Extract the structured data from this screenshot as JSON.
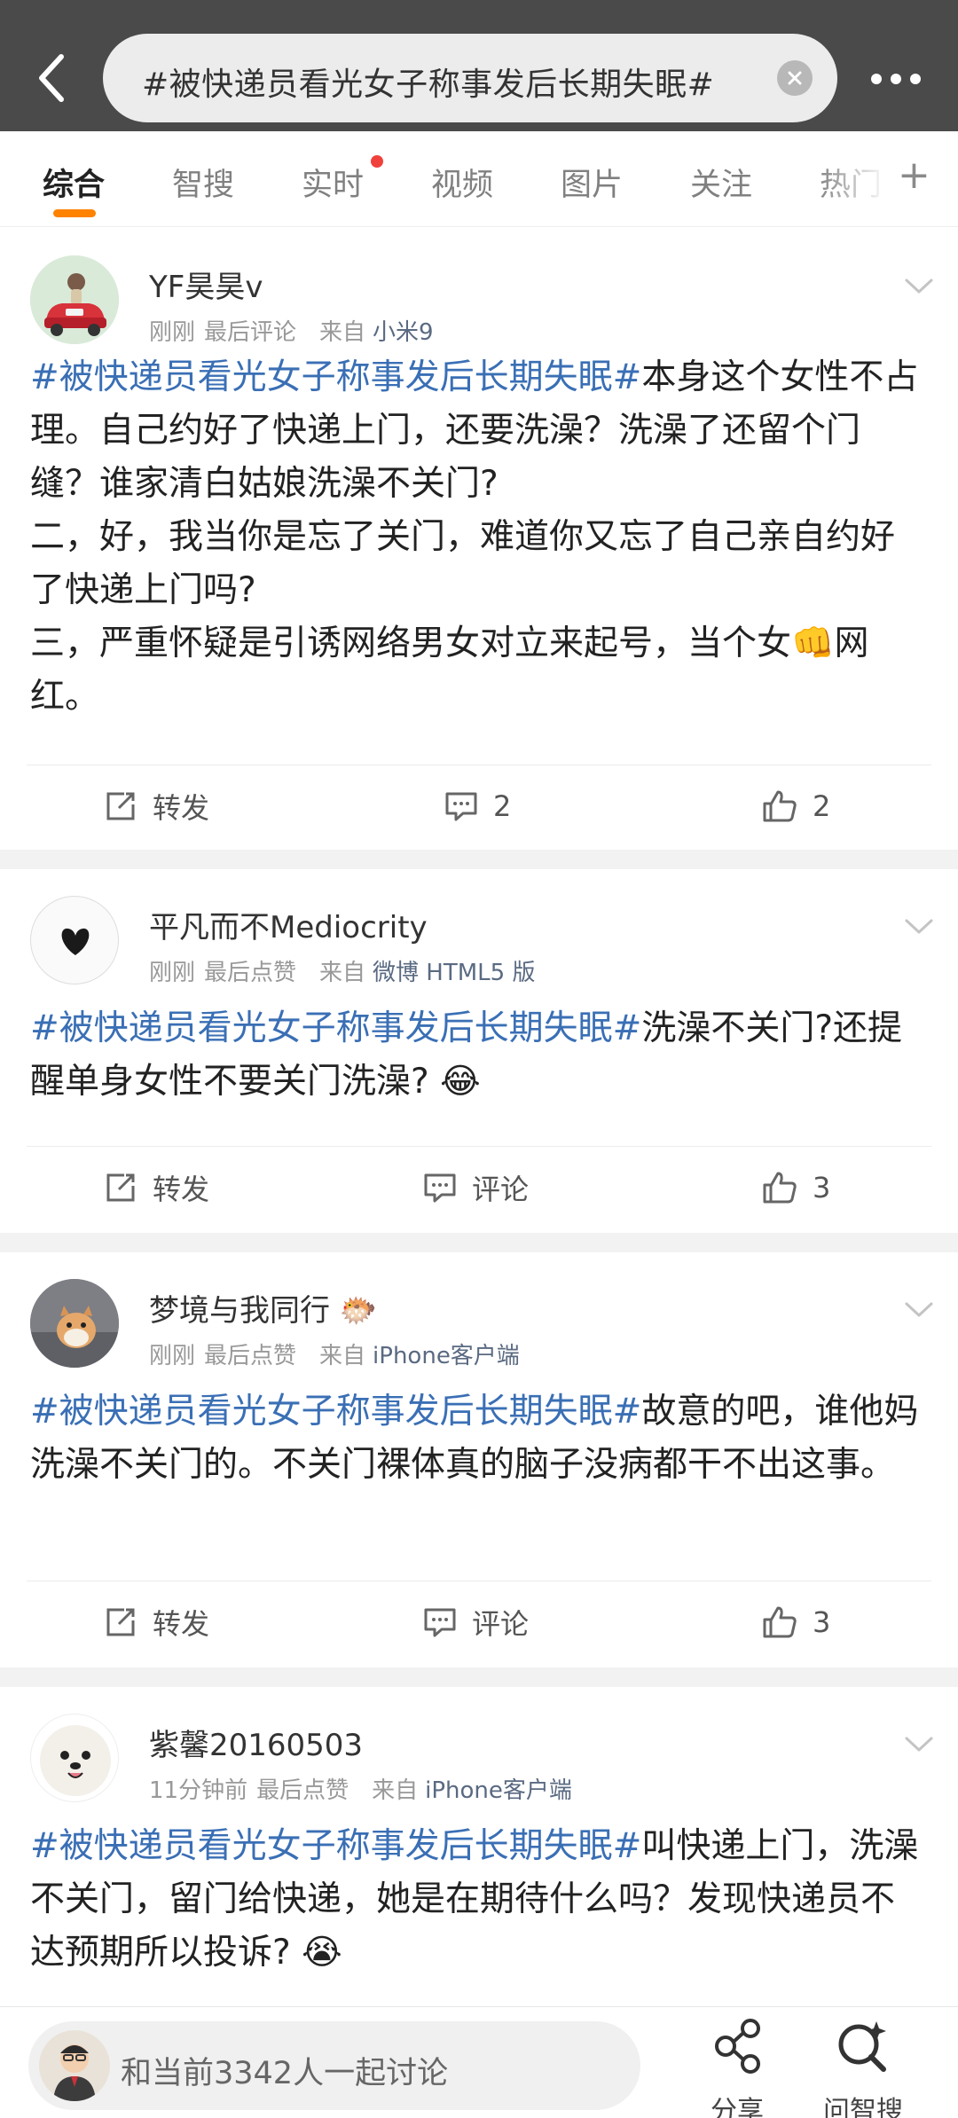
{
  "search": {
    "query": "#被快递员看光女子称事发后长期失眠#"
  },
  "tabs": [
    {
      "label": "综合"
    },
    {
      "label": "智搜"
    },
    {
      "label": "实时"
    },
    {
      "label": "视频"
    },
    {
      "label": "图片"
    },
    {
      "label": "关注"
    },
    {
      "label": "热门"
    }
  ],
  "posts": [
    {
      "username": "YF昊昊v",
      "time": "刚刚",
      "activity": "最后评论",
      "source_prefix": "来自",
      "source": "小米9",
      "hashtag": "#被快递员看光女子称事发后长期失眠#",
      "text": "本身这个女性不占理。自己约好了快递上门，还要洗澡？洗澡了还留个门缝？谁家清白姑娘洗澡不关门?",
      "extra_lines": [
        "二，好，我当你是忘了关门，难道你又忘了自己亲自约好了快递上门吗?",
        "三，严重怀疑是引诱网络男女对立来起号，当个女👊网红。"
      ],
      "repost_label": "转发",
      "comment_label": "2",
      "like_count": "2"
    },
    {
      "username": "平凡而不Mediocrity",
      "time": "刚刚",
      "activity": "最后点赞",
      "source_prefix": "来自",
      "source": "微博 HTML5 版",
      "hashtag": "#被快递员看光女子称事发后长期失眠#",
      "text": "洗澡不关门?还提醒单身女性不要关门洗澡? 😂",
      "extra_lines": [],
      "repost_label": "转发",
      "comment_label": "评论",
      "like_count": "3"
    },
    {
      "username": "梦境与我同行",
      "username_emoji": "🐡",
      "time": "刚刚",
      "activity": "最后点赞",
      "source_prefix": "来自",
      "source": "iPhone客户端",
      "hashtag": "#被快递员看光女子称事发后长期失眠#",
      "text": "故意的吧，谁他妈洗澡不关门的。不关门裸体真的脑子没病都干不出这事。",
      "extra_lines": [],
      "repost_label": "转发",
      "comment_label": "评论",
      "like_count": "3"
    },
    {
      "username": "紫馨20160503",
      "time": "11分钟前",
      "activity": "最后点赞",
      "source_prefix": "来自",
      "source": "iPhone客户端",
      "hashtag": "#被快递员看光女子称事发后长期失眠#",
      "text": "叫快递上门，洗澡不关门，留门给快递，她是在期待什么吗？发现快递员不达预期所以投诉? 😭"
    }
  ],
  "bottom": {
    "discuss_text": "和当前3342人一起讨论",
    "share_label": "分享",
    "ask_label": "问智搜"
  },
  "colors": {
    "accent": "#ff8200",
    "hashtag": "#3a6fb5",
    "badge": "#f0413c"
  }
}
